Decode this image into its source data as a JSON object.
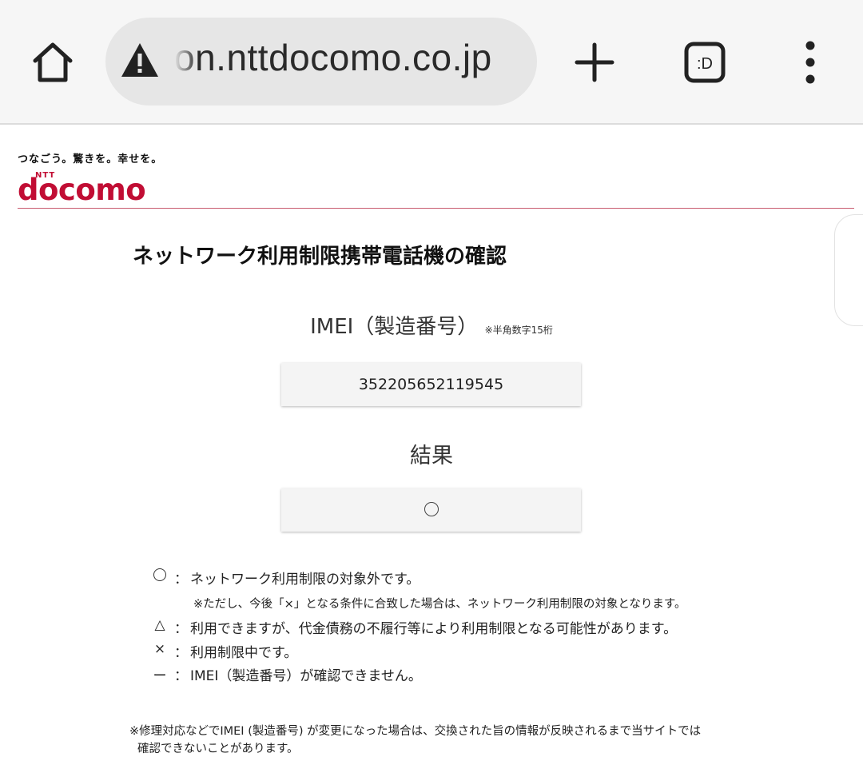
{
  "browser": {
    "url": "on.nttdocomo.co.jp",
    "tabs_icon_label": ":D",
    "icons": [
      "home-icon",
      "warning-icon",
      "plus-icon",
      "tabs-icon",
      "more-vert-icon"
    ]
  },
  "header": {
    "tagline": "つなごう。驚きを。幸せを。",
    "logo_ntt": "NTT",
    "logo_text": "docomo",
    "brand_color": "#c10d34"
  },
  "main": {
    "title": "ネットワーク利用制限携帯電話機の確認",
    "imei_label": "IMEI（製造番号）",
    "imei_hint": "※半角数字15桁",
    "imei_value": "352205652119545",
    "result_label": "結果",
    "result_value": "○"
  },
  "legend": {
    "items": [
      {
        "symbol": "○",
        "colon": "：",
        "text": "ネットワーク利用制限の対象外です。"
      },
      {
        "symbol": "△",
        "colon": "：",
        "text": "利用できますが、代金債務の不履行等により利用制限となる可能性があります。"
      },
      {
        "symbol": "×",
        "colon": "：",
        "text": "利用制限中です。"
      },
      {
        "symbol": "ー",
        "colon": "：",
        "text": "IMEI（製造番号）が確認できません。"
      }
    ],
    "note": "※ただし、今後「×」となる条件に合致した場合は、ネットワーク利用制限の対象となります。"
  },
  "footnote": {
    "line1": "※修理対応などでIMEI (製造番号) が変更になった場合は、交換された旨の情報が反映されるまで当サイトでは",
    "line2": "確認できないことがあります。"
  }
}
